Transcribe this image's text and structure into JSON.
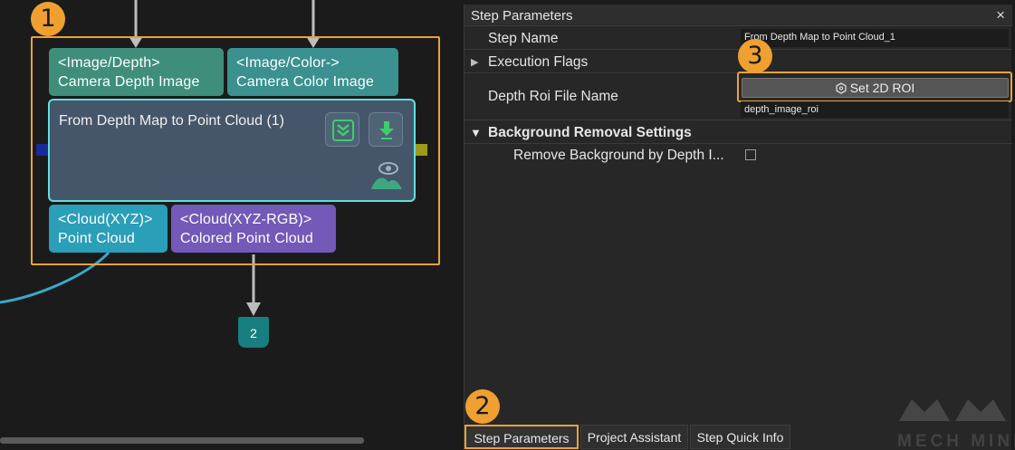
{
  "callouts": {
    "one": "1",
    "two": "2",
    "three": "3"
  },
  "node": {
    "inputs": [
      {
        "type": "<Image/Depth>",
        "name": "Camera Depth Image"
      },
      {
        "type": "<Image/Color->",
        "name": "Camera Color Image"
      }
    ],
    "title": "From Depth Map to Point Cloud (1)",
    "outputs": [
      {
        "type": "<Cloud(XYZ)>",
        "name": "Point Cloud"
      },
      {
        "type": "<Cloud(XYZ-RGB)>",
        "name": "Colored Point Cloud"
      }
    ],
    "next_step_badge": "2"
  },
  "panel": {
    "title": "Step Parameters",
    "close_glyph": "×",
    "rows": {
      "step_name_label": "Step Name",
      "step_name_value": "From Depth Map to Point Cloud_1",
      "execution_flags_label": "Execution Flags",
      "depth_roi_label": "Depth Roi File Name",
      "set_roi_button": "Set 2D ROI",
      "depth_roi_value": "depth_image_roi",
      "bg_removal_label": "Background Removal Settings",
      "remove_bg_label": "Remove Background by Depth I..."
    },
    "remove_bg_checked": false
  },
  "tabs": [
    {
      "label": "Step Parameters",
      "active": true
    },
    {
      "label": "Project Assistant",
      "active": false
    },
    {
      "label": "Step Quick Info",
      "active": false
    }
  ],
  "watermark": "MECH MIND",
  "colors": {
    "highlight": "#e8a23a",
    "depth_port": "#3f8e7c",
    "color_port": "#3a918f",
    "cloud_port": "#2b9eb8",
    "rgb_port": "#7359b8",
    "node_border": "#5fe0dc",
    "badge": "#177f7f"
  }
}
